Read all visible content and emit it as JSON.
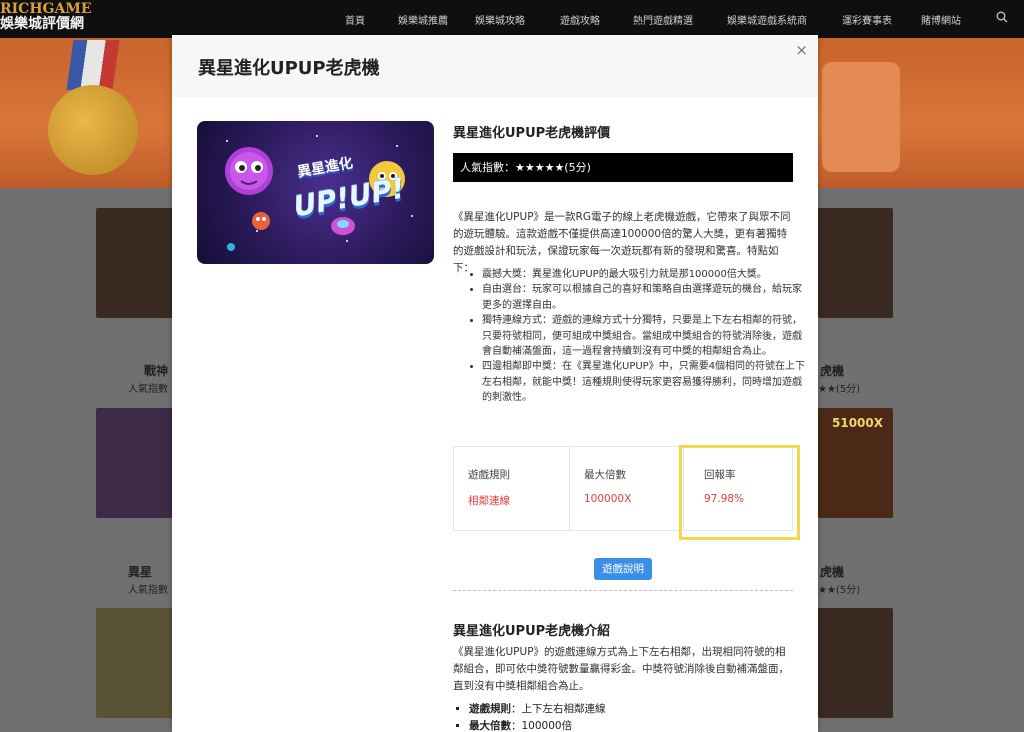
{
  "site": {
    "logo_line1": "RICHGAME",
    "logo_line2": "娛樂城評價網",
    "nav": [
      "首頁",
      "娛樂城推薦",
      "娛樂城攻略",
      "遊戲攻略",
      "熱門遊戲精選",
      "娛樂城遊戲系統商",
      "運彩賽事表",
      "賭博網站"
    ]
  },
  "background_cards": {
    "left_title_1": "戰神",
    "left_sub_1": "人氣指數",
    "right_title_1": "虎機",
    "right_sub_1": "★★(5分)",
    "left_title_2": "異星",
    "left_sub_2": "人氣指數",
    "right_title_2": "虎機",
    "right_sub_2": "★★(5分)",
    "badge_51000x": "51000X"
  },
  "modal": {
    "title": "異星進化UPUP老虎機",
    "close": "×",
    "art_title": "異星進化",
    "art_sub": "UP!UP!",
    "review_title": "異星進化UPUP老虎機評價",
    "rating_text": "人氣指數：★★★★★(5分)",
    "intro": "《異星進化UPUP》是一款RG電子的線上老虎機遊戲，它帶來了與眾不同的遊玩體驗。這款遊戲不僅提供高達100000倍的驚人大獎，更有著獨特的遊戲設計和玩法，保證玩家每一次遊玩都有新的發現和驚喜。特點如下：",
    "features": [
      "震撼大獎：異星進化UPUP的最大吸引力就是那100000倍大獎。",
      "自由選台：玩家可以根據自己的喜好和策略自由選擇遊玩的機台，給玩家更多的選擇自由。",
      "獨特連線方式：遊戲的連線方式十分獨特，只要是上下左右相鄰的符號，只要符號相同，便可組成中獎組合。當組成中獎組合的符號消除後，遊戲會自動補滿盤面，這一過程會持續到沒有可中獎的相鄰組合為止。",
      "四邊相鄰即中獎：在《異星進化UPUP》中，只需要4個相同的符號在上下左右相鄰，就能中獎！這種規則使得玩家更容易獲得勝利，同時增加遊戲的刺激性。"
    ],
    "stats": [
      {
        "label": "遊戲規則",
        "value": "相鄰連線"
      },
      {
        "label": "最大倍數",
        "value": "100000X"
      },
      {
        "label": "回報率",
        "value": "97.98%"
      }
    ],
    "rules_button": "遊戲說明",
    "intro2_title": "異星進化UPUP老虎機介紹",
    "intro2_text": "《異星進化UPUP》的遊戲連線方式為上下左右相鄰，出現相同符號的相鄰組合，即可依中獎符號數量贏得彩金。中獎符號消除後自動補滿盤面，直到沒有中獎相鄰組合為止。",
    "summary": [
      {
        "label": "遊戲規則",
        "value": "上下左右相鄰連線"
      },
      {
        "label": "最大倍數",
        "value": "100000倍"
      }
    ]
  },
  "colors": {
    "accent_button": "#3a8ee6",
    "stat_value": "#e0403a",
    "highlight_border": "#f2d64b",
    "rating_bar": "#000000"
  }
}
